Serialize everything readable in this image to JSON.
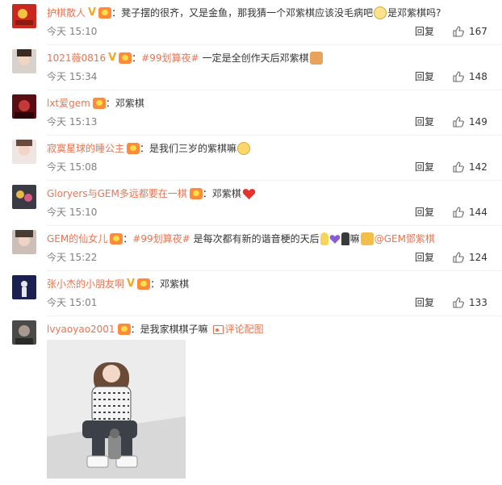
{
  "comments": [
    {
      "username": "护棋散人",
      "has_v": true,
      "has_fan_badge": true,
      "tag": "",
      "text": "凳子摆的很齐，又是金鱼，那我猜一个邓紫棋应该没毛病吧",
      "emoji_after": "glasses-emoji",
      "text2": "是邓紫棋吗?",
      "time": "今天 15:10",
      "reply": "回复",
      "likes": "167"
    },
    {
      "username": "1021薇0816",
      "has_v": true,
      "has_fan_badge": true,
      "tag": "#99划算夜#",
      "text": "一定是全创作天后邓紫棋",
      "emoji_after": "cat-emoji",
      "text2": "",
      "time": "今天 15:34",
      "reply": "回复",
      "likes": "148"
    },
    {
      "username": "lxt爱gem",
      "has_v": false,
      "has_fan_badge": true,
      "tag": "",
      "text": "邓紫棋",
      "emoji_after": "",
      "text2": "",
      "time": "今天 15:13",
      "reply": "回复",
      "likes": "149"
    },
    {
      "username": "寂寞星球的睡公主",
      "has_v": false,
      "has_fan_badge": true,
      "tag": "",
      "text": "是我们三岁的紫棋嘛",
      "emoji_after": "sweet-emoji",
      "text2": "",
      "time": "今天 15:08",
      "reply": "回复",
      "likes": "142"
    },
    {
      "username": "Gloryers与GEM多远都要在一棋",
      "has_v": false,
      "has_fan_badge": true,
      "tag": "",
      "text": "邓紫棋",
      "emoji_after": "heart-emoji",
      "text2": "",
      "time": "今天 15:10",
      "reply": "回复",
      "likes": "144"
    },
    {
      "username": "GEM的仙女儿",
      "has_v": false,
      "has_fan_badge": true,
      "tag": "#99划算夜#",
      "text": "是每次都有新的谐音梗的天后",
      "emoji_after": "multi-emoji",
      "text2": "嘛",
      "mention": "@GEM鄧紫棋",
      "time": "今天 15:22",
      "reply": "回复",
      "likes": "124"
    },
    {
      "username": "张小杰的小朋友啊",
      "has_v": true,
      "has_fan_badge": true,
      "tag": "",
      "text": "邓紫棋",
      "emoji_after": "",
      "text2": "",
      "time": "今天 15:01",
      "reply": "回复",
      "likes": "133"
    },
    {
      "username": "lvyaoyao2001",
      "has_v": false,
      "has_fan_badge": true,
      "tag": "",
      "text": "是我家棋棋子嘛",
      "emoji_after": "",
      "text2": "",
      "pic_label": "评论配图",
      "time": "",
      "reply": "",
      "likes": ""
    }
  ],
  "colors": {
    "accent": "#eb7350",
    "meta": "#808080",
    "text": "#333333"
  }
}
